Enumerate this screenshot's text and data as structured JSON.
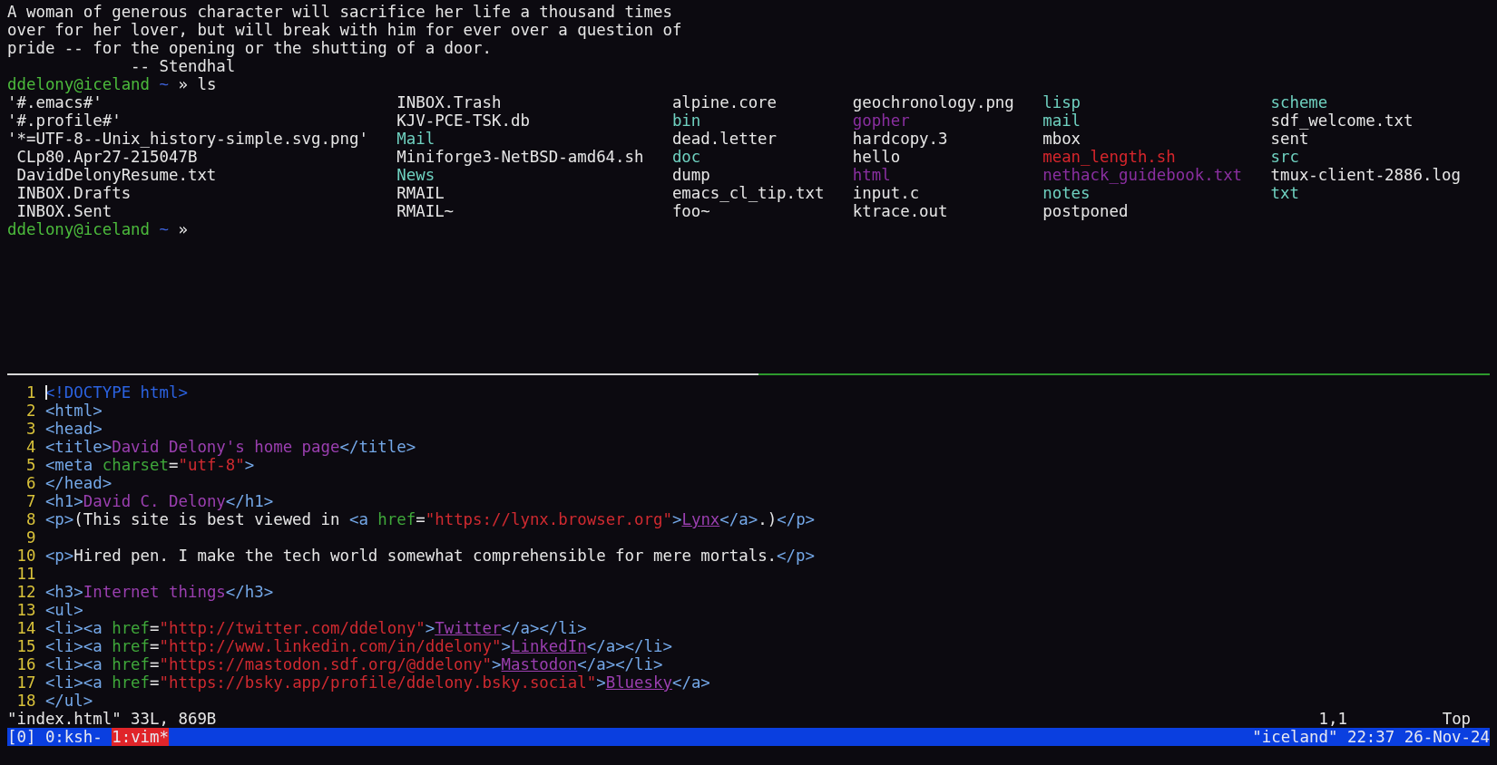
{
  "top_pane": {
    "lines": [
      {
        "kind": "text",
        "text": "A woman of generous character will sacrifice her life a thousand times"
      },
      {
        "kind": "text",
        "text": "over for her lover, but will break with him for ever over a question of"
      },
      {
        "kind": "text",
        "text": "pride -- for the opening or the shutting of a door."
      },
      {
        "kind": "attribution",
        "text": "-- Stendhal"
      },
      {
        "kind": "prompt",
        "user_host": "ddelony@iceland",
        "path": "~",
        "symbol": "»",
        "command": "ls"
      },
      {
        "kind": "listing",
        "columns": [
          [
            {
              "text": "'#.emacs#'",
              "kind": "file"
            },
            {
              "text": "'#.profile#'",
              "kind": "file"
            },
            {
              "text": "'*=UTF-8--Unix_history-simple.svg.png'",
              "kind": "file"
            },
            {
              "text": " CLp80.Apr27-215047B",
              "kind": "file"
            },
            {
              "text": " DavidDelonyResume.txt",
              "kind": "file"
            },
            {
              "text": " INBOX.Drafts",
              "kind": "file"
            },
            {
              "text": " INBOX.Sent",
              "kind": "file"
            }
          ],
          [
            {
              "text": "INBOX.Trash",
              "kind": "file"
            },
            {
              "text": "KJV-PCE-TSK.db",
              "kind": "file"
            },
            {
              "text": "Mail",
              "kind": "dir"
            },
            {
              "text": "Miniforge3-NetBSD-amd64.sh",
              "kind": "file"
            },
            {
              "text": "News",
              "kind": "dir"
            },
            {
              "text": "RMAIL",
              "kind": "file"
            },
            {
              "text": "RMAIL~",
              "kind": "file"
            }
          ],
          [
            {
              "text": "alpine.core",
              "kind": "file"
            },
            {
              "text": "bin",
              "kind": "dir"
            },
            {
              "text": "dead.letter",
              "kind": "file"
            },
            {
              "text": "doc",
              "kind": "dir"
            },
            {
              "text": "dump",
              "kind": "file"
            },
            {
              "text": "emacs_cl_tip.txt",
              "kind": "file"
            },
            {
              "text": "foo~",
              "kind": "file"
            }
          ],
          [
            {
              "text": "geochronology.png",
              "kind": "file"
            },
            {
              "text": "gopher",
              "kind": "symlink"
            },
            {
              "text": "hardcopy.3",
              "kind": "file"
            },
            {
              "text": "hello",
              "kind": "file"
            },
            {
              "text": "html",
              "kind": "symlink"
            },
            {
              "text": "input.c",
              "kind": "file"
            },
            {
              "text": "ktrace.out",
              "kind": "file"
            }
          ],
          [
            {
              "text": "lisp",
              "kind": "dir"
            },
            {
              "text": "mail",
              "kind": "dir"
            },
            {
              "text": "mbox",
              "kind": "file"
            },
            {
              "text": "mean_length.sh",
              "kind": "exec"
            },
            {
              "text": "nethack_guidebook.txt",
              "kind": "symlink"
            },
            {
              "text": "notes",
              "kind": "dir"
            },
            {
              "text": "postponed",
              "kind": "file"
            }
          ],
          [
            {
              "text": "scheme",
              "kind": "dir"
            },
            {
              "text": "sdf_welcome.txt",
              "kind": "file"
            },
            {
              "text": "sent",
              "kind": "file"
            },
            {
              "text": "src",
              "kind": "dir"
            },
            {
              "text": "tmux-client-2886.log",
              "kind": "file"
            },
            {
              "text": "txt",
              "kind": "dir"
            }
          ]
        ]
      },
      {
        "kind": "prompt",
        "user_host": "ddelony@iceland",
        "path": "~",
        "symbol": "»"
      }
    ]
  },
  "editor": {
    "lines": [
      {
        "number": "1",
        "cursor": true,
        "segments": [
          {
            "kind": "doctype",
            "text": "<!DOCTYPE html>"
          }
        ]
      },
      {
        "number": "2",
        "cursor": false,
        "segments": [
          {
            "kind": "tag",
            "text": "<html>"
          }
        ]
      },
      {
        "number": "3",
        "cursor": false,
        "segments": [
          {
            "kind": "tag",
            "text": "<head>"
          }
        ]
      },
      {
        "number": "4",
        "cursor": false,
        "segments": [
          {
            "kind": "tag",
            "text": "<title>"
          },
          {
            "kind": "title",
            "text": "David Delony's home page"
          },
          {
            "kind": "tag",
            "text": "</title>"
          }
        ]
      },
      {
        "number": "5",
        "cursor": false,
        "segments": [
          {
            "kind": "tag",
            "text": "<meta "
          },
          {
            "kind": "attr",
            "text": "charset"
          },
          {
            "kind": "text",
            "text": "="
          },
          {
            "kind": "string",
            "text": "\"utf-8\""
          },
          {
            "kind": "tag",
            "text": ">"
          }
        ]
      },
      {
        "number": "6",
        "cursor": false,
        "segments": [
          {
            "kind": "tag",
            "text": "</head>"
          }
        ]
      },
      {
        "number": "7",
        "cursor": false,
        "segments": [
          {
            "kind": "tag",
            "text": "<h1>"
          },
          {
            "kind": "title",
            "text": "David C. Delony"
          },
          {
            "kind": "tag",
            "text": "</h1>"
          }
        ]
      },
      {
        "number": "8",
        "cursor": false,
        "segments": [
          {
            "kind": "tag",
            "text": "<p>"
          },
          {
            "kind": "text",
            "text": "(This site is best viewed in "
          },
          {
            "kind": "tag",
            "text": "<a "
          },
          {
            "kind": "attr",
            "text": "href"
          },
          {
            "kind": "text",
            "text": "="
          },
          {
            "kind": "string",
            "text": "\"https://lynx.browser.org\""
          },
          {
            "kind": "tag",
            "text": ">"
          },
          {
            "kind": "link",
            "text": "Lynx"
          },
          {
            "kind": "tag",
            "text": "</a>"
          },
          {
            "kind": "text",
            "text": ".)"
          },
          {
            "kind": "tag",
            "text": "</p>"
          }
        ]
      },
      {
        "number": "9",
        "cursor": false
      },
      {
        "number": "10",
        "cursor": false,
        "segments": [
          {
            "kind": "tag",
            "text": "<p>"
          },
          {
            "kind": "text",
            "text": "Hired pen. I make the tech world somewhat comprehensible for mere mortals."
          },
          {
            "kind": "tag",
            "text": "</p>"
          }
        ]
      },
      {
        "number": "11",
        "cursor": false
      },
      {
        "number": "12",
        "cursor": false,
        "segments": [
          {
            "kind": "tag",
            "text": "<h3>"
          },
          {
            "kind": "title",
            "text": "Internet things"
          },
          {
            "kind": "tag",
            "text": "</h3>"
          }
        ]
      },
      {
        "number": "13",
        "cursor": false,
        "segments": [
          {
            "kind": "tag",
            "text": "<ul>"
          }
        ]
      },
      {
        "number": "14",
        "cursor": false,
        "segments": [
          {
            "kind": "tag",
            "text": "<li><a "
          },
          {
            "kind": "attr",
            "text": "href"
          },
          {
            "kind": "text",
            "text": "="
          },
          {
            "kind": "string",
            "text": "\"http://twitter.com/ddelony\""
          },
          {
            "kind": "tag",
            "text": ">"
          },
          {
            "kind": "link",
            "text": "Twitter"
          },
          {
            "kind": "tag",
            "text": "</a></li>"
          }
        ]
      },
      {
        "number": "15",
        "cursor": false,
        "segments": [
          {
            "kind": "tag",
            "text": "<li><a "
          },
          {
            "kind": "attr",
            "text": "href"
          },
          {
            "kind": "text",
            "text": "="
          },
          {
            "kind": "string",
            "text": "\"http://www.linkedin.com/in/ddelony\""
          },
          {
            "kind": "tag",
            "text": ">"
          },
          {
            "kind": "link",
            "text": "LinkedIn"
          },
          {
            "kind": "tag",
            "text": "</a></li>"
          }
        ]
      },
      {
        "number": "16",
        "cursor": false,
        "segments": [
          {
            "kind": "tag",
            "text": "<li><a "
          },
          {
            "kind": "attr",
            "text": "href"
          },
          {
            "kind": "text",
            "text": "="
          },
          {
            "kind": "string",
            "text": "\"https://mastodon.sdf.org/@ddelony\""
          },
          {
            "kind": "tag",
            "text": ">"
          },
          {
            "kind": "link",
            "text": "Mastodon"
          },
          {
            "kind": "tag",
            "text": "</a></li>"
          }
        ]
      },
      {
        "number": "17",
        "cursor": false,
        "segments": [
          {
            "kind": "tag",
            "text": "<li><a "
          },
          {
            "kind": "attr",
            "text": "href"
          },
          {
            "kind": "text",
            "text": "="
          },
          {
            "kind": "string",
            "text": "\"https://bsky.app/profile/ddelony.bsky.social\""
          },
          {
            "kind": "tag",
            "text": ">"
          },
          {
            "kind": "link",
            "text": "Bluesky"
          },
          {
            "kind": "tag",
            "text": "</a>"
          }
        ]
      },
      {
        "number": "18",
        "cursor": false,
        "segments": [
          {
            "kind": "tag",
            "text": "</ul>"
          }
        ]
      }
    ],
    "message": "\"index.html\" 33L, 869B",
    "ruler": "1,1",
    "position": "Top"
  },
  "status_bar": {
    "session": "[0]",
    "windows": [
      {
        "label": "0:ksh-",
        "selected": false
      },
      {
        "label": "1:vim*",
        "selected": true
      }
    ],
    "info": "\"iceland\" 22:37 26-Nov-24"
  }
}
